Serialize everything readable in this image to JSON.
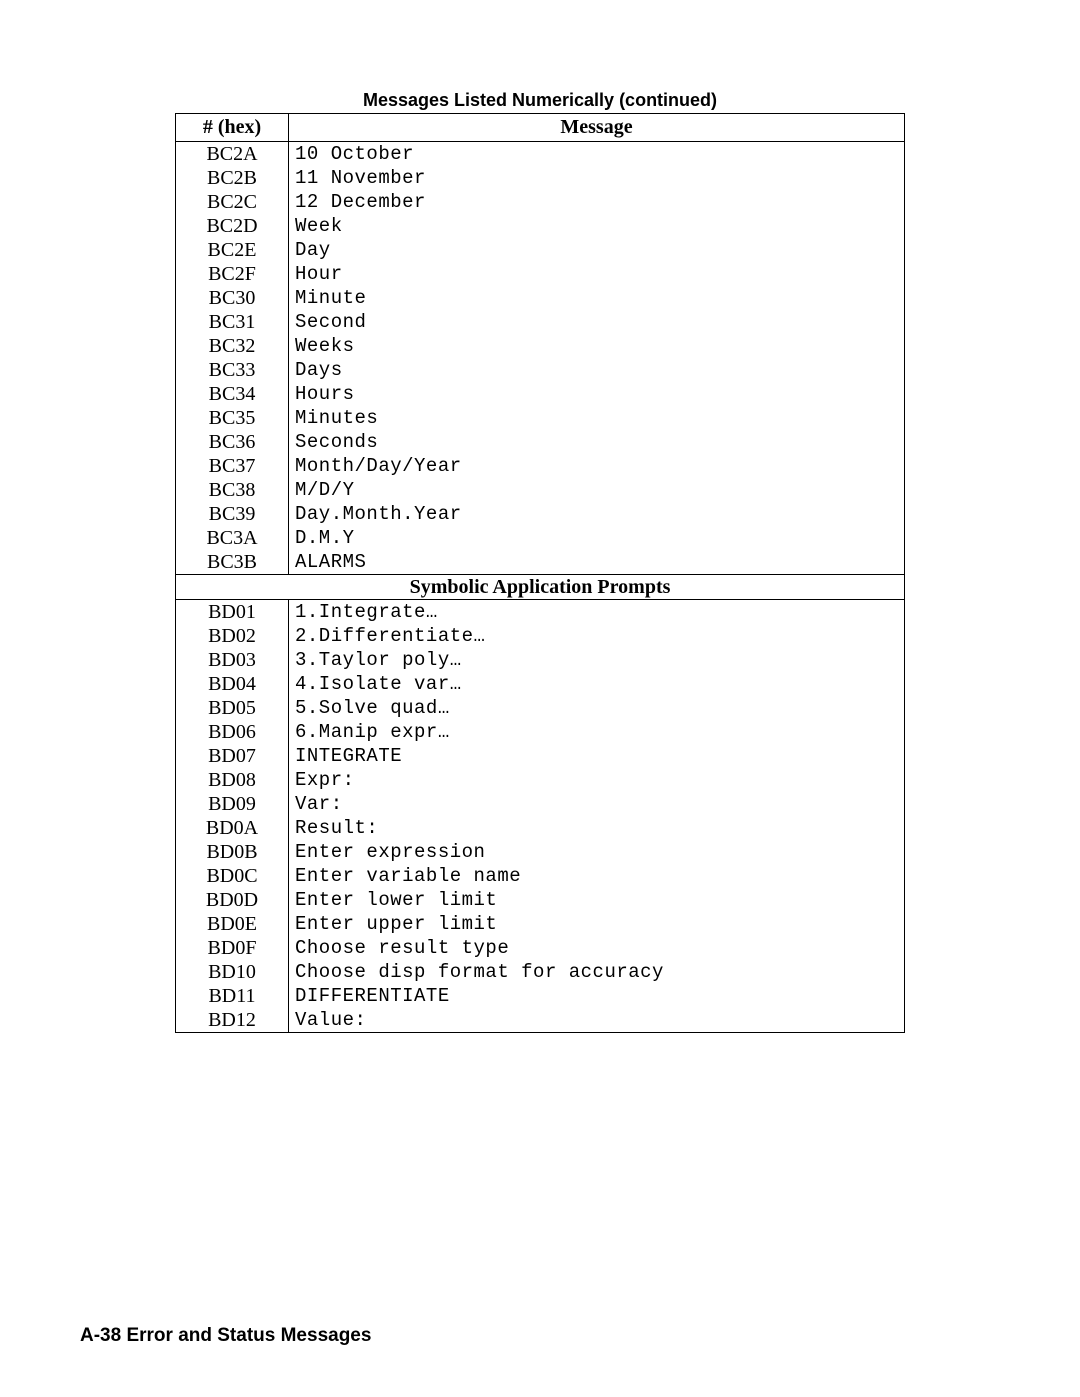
{
  "caption": "Messages Listed Numerically (continued)",
  "headers": {
    "hex": "# (hex)",
    "message": "Message"
  },
  "rows_a": [
    {
      "hex": "BC2A",
      "msg": "10 October"
    },
    {
      "hex": "BC2B",
      "msg": "11 November"
    },
    {
      "hex": "BC2C",
      "msg": "12 December"
    },
    {
      "hex": "BC2D",
      "msg": "Week"
    },
    {
      "hex": "BC2E",
      "msg": "Day"
    },
    {
      "hex": "BC2F",
      "msg": "Hour"
    },
    {
      "hex": "BC30",
      "msg": "Minute"
    },
    {
      "hex": "BC31",
      "msg": "Second"
    },
    {
      "hex": "BC32",
      "msg": "Weeks"
    },
    {
      "hex": "BC33",
      "msg": "Days"
    },
    {
      "hex": "BC34",
      "msg": "Hours"
    },
    {
      "hex": "BC35",
      "msg": "Minutes"
    },
    {
      "hex": "BC36",
      "msg": "Seconds"
    },
    {
      "hex": "BC37",
      "msg": "Month/Day/Year"
    },
    {
      "hex": "BC38",
      "msg": "M/D/Y"
    },
    {
      "hex": "BC39",
      "msg": "Day.Month.Year"
    },
    {
      "hex": "BC3A",
      "msg": "D.M.Y"
    },
    {
      "hex": "BC3B",
      "msg": "ALARMS"
    }
  ],
  "section_title": "Symbolic Application Prompts",
  "rows_b": [
    {
      "hex": "BD01",
      "msg": "1.Integrate…"
    },
    {
      "hex": "BD02",
      "msg": "2.Differentiate…"
    },
    {
      "hex": "BD03",
      "msg": "3.Taylor poly…"
    },
    {
      "hex": "BD04",
      "msg": "4.Isolate var…"
    },
    {
      "hex": "BD05",
      "msg": "5.Solve quad…"
    },
    {
      "hex": "BD06",
      "msg": "6.Manip expr…"
    },
    {
      "hex": "BD07",
      "msg": "INTEGRATE"
    },
    {
      "hex": "BD08",
      "msg": "Expr:"
    },
    {
      "hex": "BD09",
      "msg": "Var:"
    },
    {
      "hex": "BD0A",
      "msg": "Result:"
    },
    {
      "hex": "BD0B",
      "msg": "Enter expression"
    },
    {
      "hex": "BD0C",
      "msg": "Enter variable name"
    },
    {
      "hex": "BD0D",
      "msg": "Enter lower limit"
    },
    {
      "hex": "BD0E",
      "msg": "Enter upper limit"
    },
    {
      "hex": "BD0F",
      "msg": "Choose result type"
    },
    {
      "hex": "BD10",
      "msg": "Choose disp format for accuracy"
    },
    {
      "hex": "BD11",
      "msg": "DIFFERENTIATE"
    },
    {
      "hex": "BD12",
      "msg": "Value:"
    }
  ],
  "footer": "A-38   Error and Status Messages"
}
